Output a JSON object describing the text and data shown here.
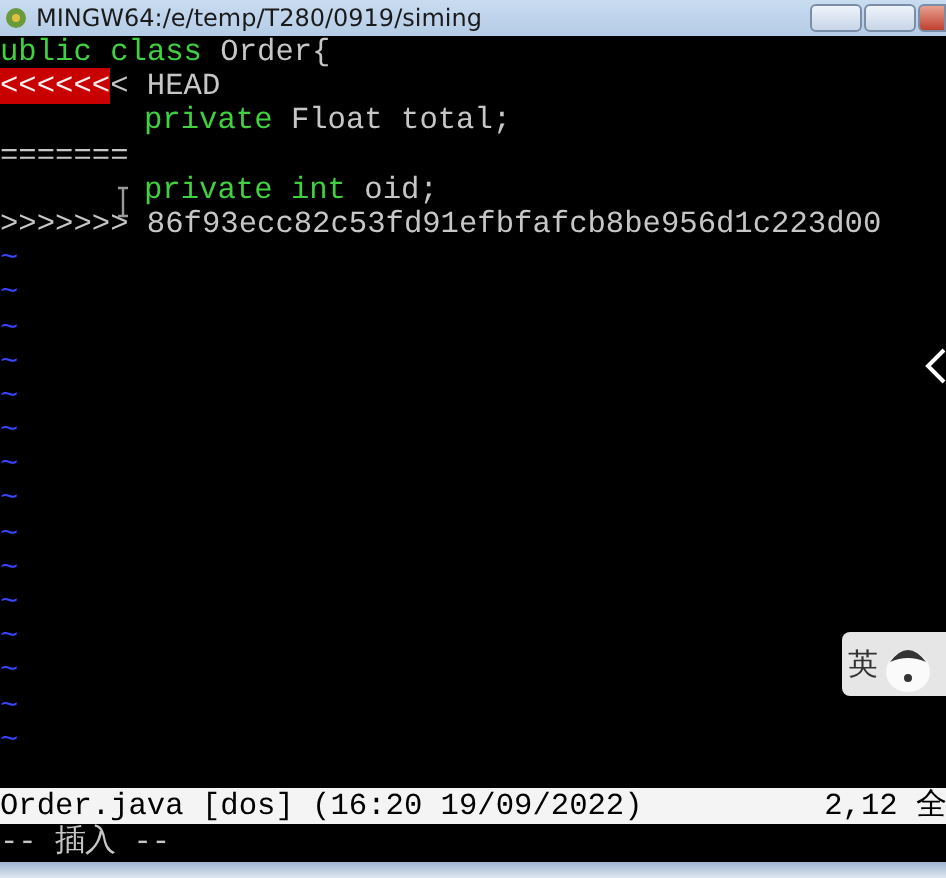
{
  "window": {
    "title": "MINGW64:/e/temp/T280/0919/siming"
  },
  "lines": [
    {
      "indented": false,
      "segments": [
        {
          "kind": "keyword",
          "text": "ublic"
        },
        {
          "kind": "keyword",
          "text": " class"
        },
        {
          "kind": "plain",
          "text": " Order{"
        }
      ]
    },
    {
      "indented": false,
      "segments": [
        {
          "kind": "conflict",
          "text": "<<<<<<"
        },
        {
          "kind": "plain",
          "text": "< HEAD"
        }
      ]
    },
    {
      "indented": true,
      "segments": [
        {
          "kind": "keyword",
          "text": "private"
        },
        {
          "kind": "plain",
          "text": " Float total;"
        }
      ]
    },
    {
      "indented": false,
      "segments": [
        {
          "kind": "plain",
          "text": "======="
        }
      ]
    },
    {
      "indented": true,
      "segments": [
        {
          "kind": "keyword",
          "text": "private"
        },
        {
          "kind": "keyword",
          "text": " int"
        },
        {
          "kind": "plain",
          "text": " oid;"
        }
      ]
    },
    {
      "indented": false,
      "segments": [
        {
          "kind": "plain",
          "text": ">>>>>>> 86f93ecc82c53fd91efbfafcb8be956d1c223d00"
        }
      ]
    },
    {
      "indented": false,
      "segments": [
        {
          "kind": "filler",
          "text": "~"
        }
      ]
    },
    {
      "indented": false,
      "segments": [
        {
          "kind": "filler",
          "text": "~"
        }
      ]
    },
    {
      "indented": false,
      "segments": [
        {
          "kind": "filler",
          "text": "~"
        }
      ]
    },
    {
      "indented": false,
      "segments": [
        {
          "kind": "filler",
          "text": "~"
        }
      ]
    },
    {
      "indented": false,
      "segments": [
        {
          "kind": "filler",
          "text": "~"
        }
      ]
    },
    {
      "indented": false,
      "segments": [
        {
          "kind": "filler",
          "text": "~"
        }
      ]
    },
    {
      "indented": false,
      "segments": [
        {
          "kind": "filler",
          "text": "~"
        }
      ]
    },
    {
      "indented": false,
      "segments": [
        {
          "kind": "filler",
          "text": "~"
        }
      ]
    },
    {
      "indented": false,
      "segments": [
        {
          "kind": "filler",
          "text": "~"
        }
      ]
    },
    {
      "indented": false,
      "segments": [
        {
          "kind": "filler",
          "text": "~"
        }
      ]
    },
    {
      "indented": false,
      "segments": [
        {
          "kind": "filler",
          "text": "~"
        }
      ]
    },
    {
      "indented": false,
      "segments": [
        {
          "kind": "filler",
          "text": "~"
        }
      ]
    },
    {
      "indented": false,
      "segments": [
        {
          "kind": "filler",
          "text": "~"
        }
      ]
    },
    {
      "indented": false,
      "segments": [
        {
          "kind": "filler",
          "text": "~"
        }
      ]
    },
    {
      "indented": false,
      "segments": [
        {
          "kind": "filler",
          "text": "~"
        }
      ]
    }
  ],
  "status_line": {
    "file_info": "Order.java [dos] (16:20 19/09/2022)",
    "position": "2,12 全"
  },
  "mode_line": "-- 插入 --",
  "ime_indicator": {
    "label": "英"
  }
}
